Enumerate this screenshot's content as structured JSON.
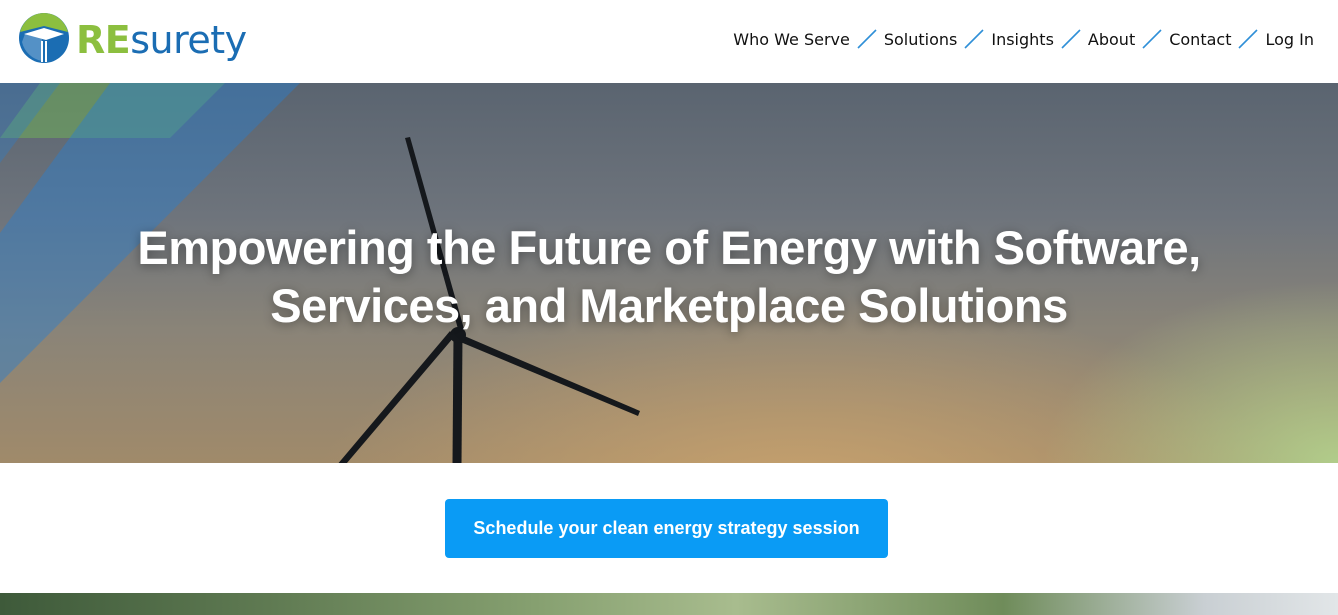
{
  "logo": {
    "part1": "RE",
    "part2": "surety",
    "icon": "resurety-logo-mark",
    "colors": {
      "green": "#8cbf3f",
      "blue": "#1b6db3"
    }
  },
  "nav": {
    "items": [
      {
        "label": "Who We Serve"
      },
      {
        "label": "Solutions"
      },
      {
        "label": "Insights"
      },
      {
        "label": "About"
      },
      {
        "label": "Contact"
      },
      {
        "label": "Log In"
      }
    ],
    "separator_color": "#2f8fd8"
  },
  "hero": {
    "line1": "Empowering the Future of Energy with Software,",
    "line2": "Services, and Marketplace Solutions",
    "image": "wind-turbine-at-sunset"
  },
  "cta": {
    "label": "Schedule your clean energy strategy session",
    "color": "#0a9bf5"
  }
}
